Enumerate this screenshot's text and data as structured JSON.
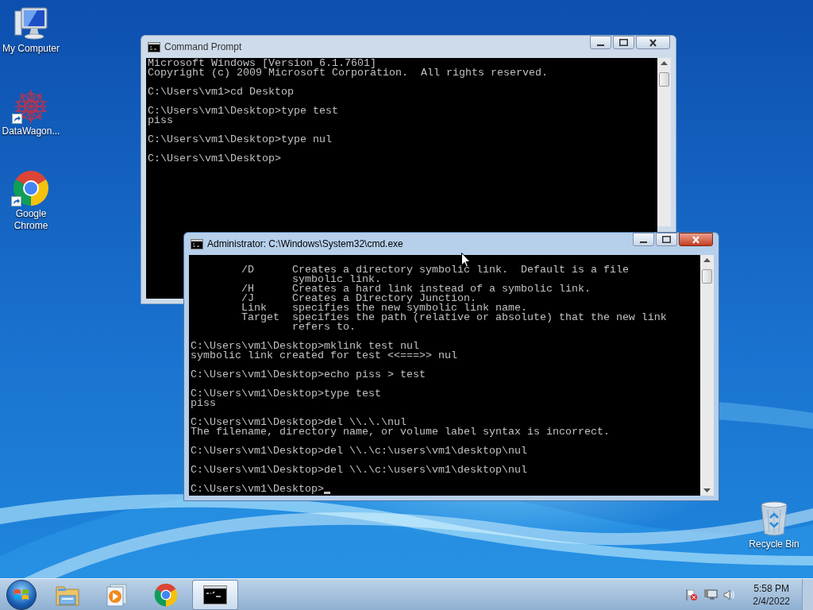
{
  "desktop_icons": [
    {
      "kind": "computer",
      "label": "My Computer",
      "shortcut": false
    },
    {
      "kind": "star",
      "label": "DataWagon...",
      "shortcut": true
    },
    {
      "kind": "chrome",
      "label": "Google Chrome",
      "shortcut": true
    },
    {
      "kind": "recycle",
      "label": "Recycle Bin",
      "shortcut": false
    }
  ],
  "windows": [
    {
      "title": "Command Prompt",
      "active": false,
      "cursor": false,
      "output": [
        [
          "Microsoft Windows [Version 6.1.7601]",
          "Copyright (c) 2009 Microsoft Corporation.  All rights reserved."
        ],
        [
          "C:\\Users\\vm1>cd Desktop"
        ],
        [
          "C:\\Users\\vm1\\Desktop>type test",
          "piss"
        ],
        [
          "C:\\Users\\vm1\\Desktop>type nul"
        ],
        [
          "C:\\Users\\vm1\\Desktop>"
        ]
      ]
    },
    {
      "title": "Administrator: C:\\Windows\\System32\\cmd.exe",
      "active": true,
      "cursor": true,
      "output": [
        [
          "        /D      Creates a directory symbolic link.  Default is a file",
          "                symbolic link.",
          "        /H      Creates a hard link instead of a symbolic link.",
          "        /J      Creates a Directory Junction.",
          "        Link    specifies the new symbolic link name.",
          "        Target  specifies the path (relative or absolute) that the new link",
          "                refers to."
        ],
        [
          "C:\\Users\\vm1\\Desktop>mklink test nul",
          "symbolic link created for test <<===>> nul"
        ],
        [
          "C:\\Users\\vm1\\Desktop>echo piss > test"
        ],
        [
          "C:\\Users\\vm1\\Desktop>type test",
          "piss"
        ],
        [
          "C:\\Users\\vm1\\Desktop>del \\\\.\\.\\nul",
          "The filename, directory name, or volume label syntax is incorrect."
        ],
        [
          "C:\\Users\\vm1\\Desktop>del \\\\.\\c:\\users\\vm1\\desktop\\nul"
        ],
        [
          "C:\\Users\\vm1\\Desktop>del \\\\.\\c:\\users\\vm1\\desktop\\nul"
        ],
        [
          "C:\\Users\\vm1\\Desktop>"
        ]
      ]
    }
  ],
  "taskbar": {
    "items": [
      {
        "kind": "explorer",
        "active": false
      },
      {
        "kind": "media",
        "active": false
      },
      {
        "kind": "chrome",
        "active": false
      },
      {
        "kind": "cmd",
        "active": true
      }
    ],
    "tray": {
      "time": "5:58 PM",
      "date": "2/4/2022"
    }
  }
}
